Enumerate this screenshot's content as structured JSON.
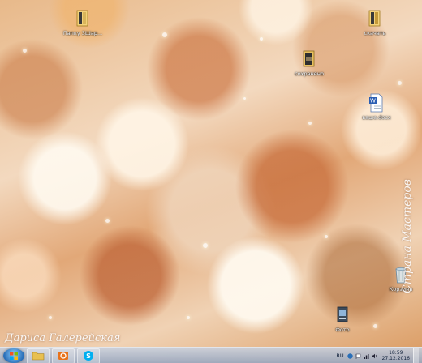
{
  "desktop_icons": [
    {
      "id": "folder-1",
      "label": "Папку 3Шар...",
      "icon": "folder-icon"
    },
    {
      "id": "folder-2",
      "label": "скачать",
      "icon": "folder-icon"
    },
    {
      "id": "folder-3",
      "label": "сохранено",
      "icon": "folder-icon"
    },
    {
      "id": "word-doc",
      "label": "ваше.docx",
      "icon": "word-document-icon"
    },
    {
      "id": "recycle-bin",
      "label": "Корзина",
      "icon": "recycle-bin-icon"
    },
    {
      "id": "program",
      "label": "Фото",
      "icon": "program-icon"
    }
  ],
  "watermark": {
    "author": "Дариса Галерейская",
    "site": "Страна Мастеров"
  },
  "taskbar": {
    "start_label": "Start",
    "language": "RU",
    "clock_time": "18:59",
    "clock_date": "27.12.2016"
  },
  "colors": {
    "taskbar": "#a6b4c8",
    "start_orb": "#2a6fb8",
    "outlook_orange": "#e8731c",
    "skype_blue": "#00aff0",
    "explorer_yellow": "#e8c050"
  }
}
